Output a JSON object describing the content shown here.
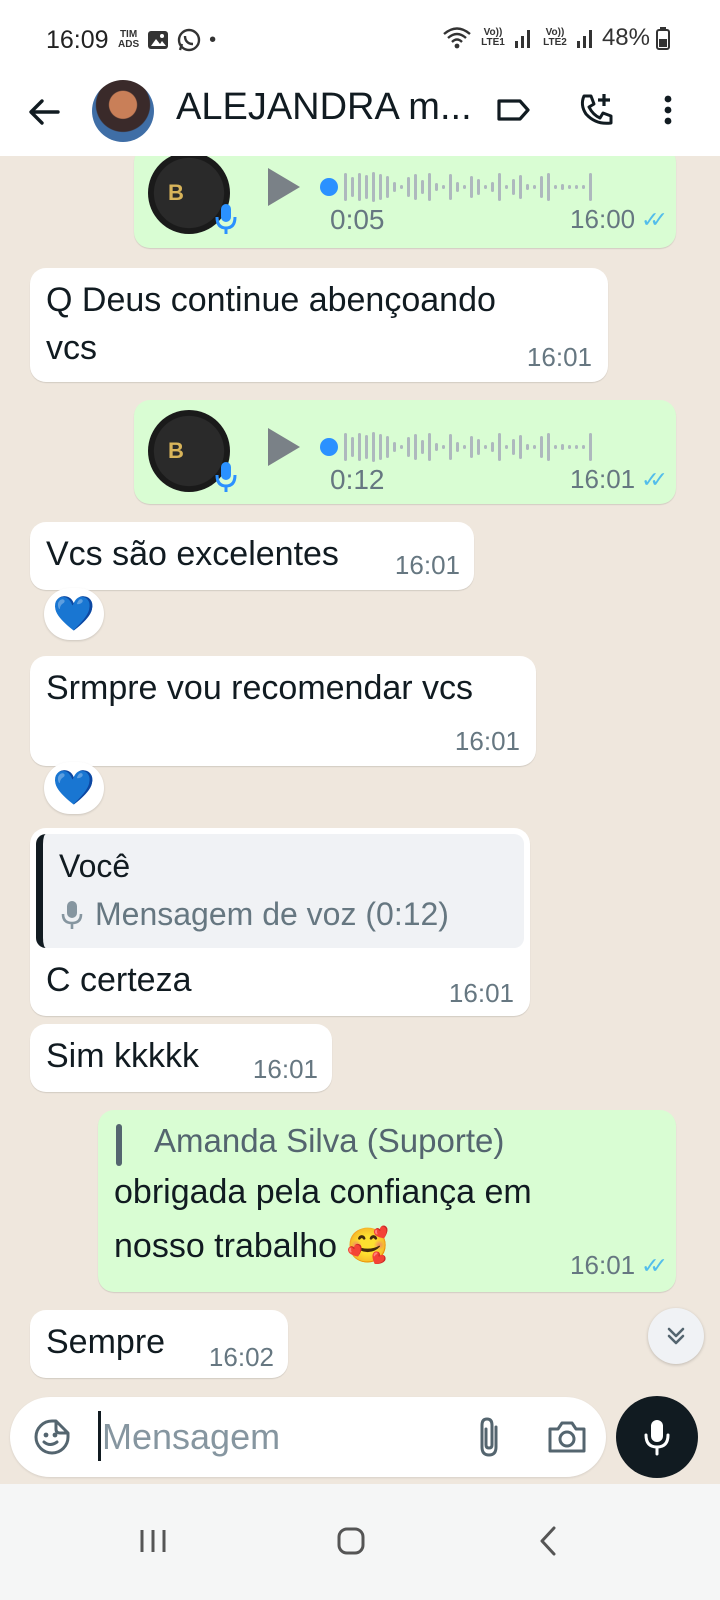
{
  "status_bar": {
    "time": "16:09",
    "carrier": "TIM\nADS",
    "sim1": "Vo)) LTE1",
    "sim2": "Vo)) LTE2",
    "battery": "48%"
  },
  "header": {
    "contact_name": "ALEJANDRA m...",
    "icons": [
      "back-arrow-icon",
      "label-icon",
      "add-call-icon",
      "more-vert-icon"
    ]
  },
  "messages": [
    {
      "type": "voice",
      "direction": "out",
      "duration": "0:05",
      "time": "16:00",
      "status": "read",
      "logo": "B"
    },
    {
      "type": "text",
      "direction": "in",
      "line1": "Q Deus continue abençoando",
      "line2": "vcs",
      "time": "16:01"
    },
    {
      "type": "voice",
      "direction": "out",
      "duration": "0:12",
      "time": "16:01",
      "status": "read",
      "logo": "B"
    },
    {
      "type": "text",
      "direction": "in",
      "text": "Vcs são excelentes",
      "time": "16:01",
      "reaction": "💙"
    },
    {
      "type": "text",
      "direction": "in",
      "text": "Srmpre vou recomendar vcs",
      "time": "16:01",
      "reaction": "💙"
    },
    {
      "type": "reply",
      "direction": "in",
      "quote_author": "Você",
      "quote_text": "Mensagem de voz (0:12)",
      "text": "C certeza",
      "time": "16:01"
    },
    {
      "type": "text",
      "direction": "in",
      "text": "Sim kkkkk",
      "time": "16:01"
    },
    {
      "type": "text",
      "direction": "out",
      "quote_author": "Amanda Silva (Suporte)",
      "line1": "obrigada pela confiança em",
      "line2": "nosso trabalho 🥰",
      "time": "16:01",
      "status": "read"
    },
    {
      "type": "text",
      "direction": "in",
      "text": "Sempre",
      "time": "16:02"
    }
  ],
  "input": {
    "placeholder": "Mensagem"
  },
  "colors": {
    "outgoing_bubble": "#d9fdd3",
    "incoming_bubble": "#ffffff",
    "chat_background": "#efe7dd",
    "read_ticks": "#53bdeb",
    "voice_dot": "#2b91ff"
  }
}
